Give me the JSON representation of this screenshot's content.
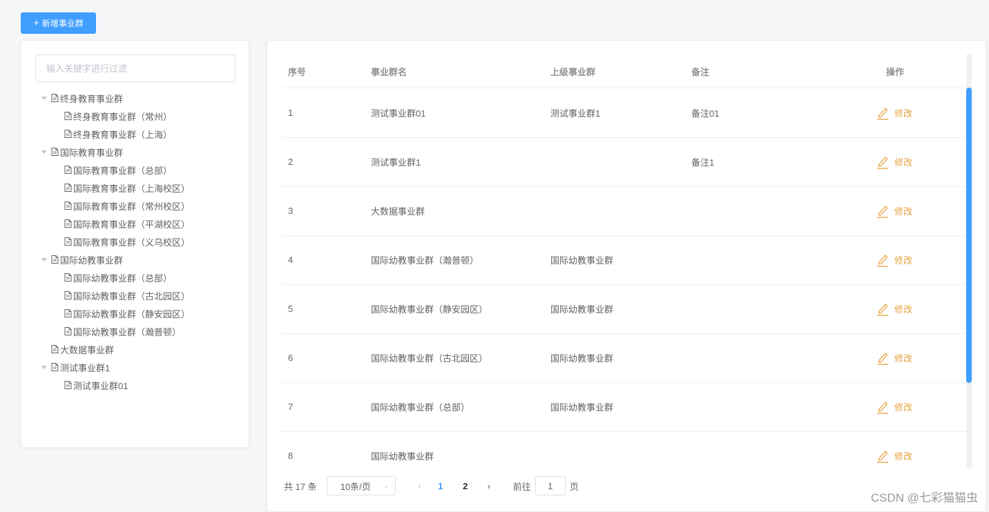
{
  "toolbar": {
    "add_label": "新增事业群",
    "add_icon": "plus-icon"
  },
  "filter": {
    "placeholder": "输入关键字进行过滤"
  },
  "tree": [
    {
      "label": "终身教育事业群",
      "level": 0,
      "expanded": true
    },
    {
      "label": "终身教育事业群（常州）",
      "level": 1
    },
    {
      "label": "终身教育事业群（上海）",
      "level": 1
    },
    {
      "label": "国际教育事业群",
      "level": 0,
      "expanded": true
    },
    {
      "label": "国际教育事业群（总部）",
      "level": 1
    },
    {
      "label": "国际教育事业群（上海校区）",
      "level": 1
    },
    {
      "label": "国际教育事业群（常州校区）",
      "level": 1
    },
    {
      "label": "国际教育事业群（平湖校区）",
      "level": 1
    },
    {
      "label": "国际教育事业群（义乌校区）",
      "level": 1
    },
    {
      "label": "国际幼教事业群",
      "level": 0,
      "expanded": true
    },
    {
      "label": "国际幼教事业群（总部）",
      "level": 1
    },
    {
      "label": "国际幼教事业群（古北园区）",
      "level": 1
    },
    {
      "label": "国际幼教事业群（静安园区）",
      "level": 1
    },
    {
      "label": "国际幼教事业群（瀚普顿）",
      "level": 1
    },
    {
      "label": "大数据事业群",
      "level": 0,
      "leaf": true
    },
    {
      "label": "测试事业群1",
      "level": 0,
      "expanded": true
    },
    {
      "label": "测试事业群01",
      "level": 1
    }
  ],
  "table": {
    "columns": [
      "序号",
      "事业群名",
      "上级事业群",
      "备注",
      "操作"
    ],
    "edit_label": "修改",
    "rows": [
      {
        "no": "1",
        "name": "测试事业群01",
        "parent": "测试事业群1",
        "note": "备注01"
      },
      {
        "no": "2",
        "name": "测试事业群1",
        "parent": "",
        "note": "备注1"
      },
      {
        "no": "3",
        "name": "大数据事业群",
        "parent": "",
        "note": ""
      },
      {
        "no": "4",
        "name": "国际幼教事业群（瀚普顿）",
        "parent": "国际幼教事业群",
        "note": ""
      },
      {
        "no": "5",
        "name": "国际幼教事业群（静安园区）",
        "parent": "国际幼教事业群",
        "note": ""
      },
      {
        "no": "6",
        "name": "国际幼教事业群（古北园区）",
        "parent": "国际幼教事业群",
        "note": ""
      },
      {
        "no": "7",
        "name": "国际幼教事业群（总部）",
        "parent": "国际幼教事业群",
        "note": ""
      },
      {
        "no": "8",
        "name": "国际幼教事业群",
        "parent": "",
        "note": ""
      }
    ]
  },
  "pagination": {
    "total_text": "共 17 条",
    "page_size": "10条/页",
    "pages": [
      "1",
      "2"
    ],
    "current_page": "1",
    "goto_label": "前往",
    "goto_value": "1",
    "page_suffix": "页"
  },
  "watermark": "CSDN @七彩猫猫虫",
  "colors": {
    "primary": "#409eff",
    "warning": "#e6a23c",
    "text": "#606266",
    "header_text": "#909399"
  }
}
